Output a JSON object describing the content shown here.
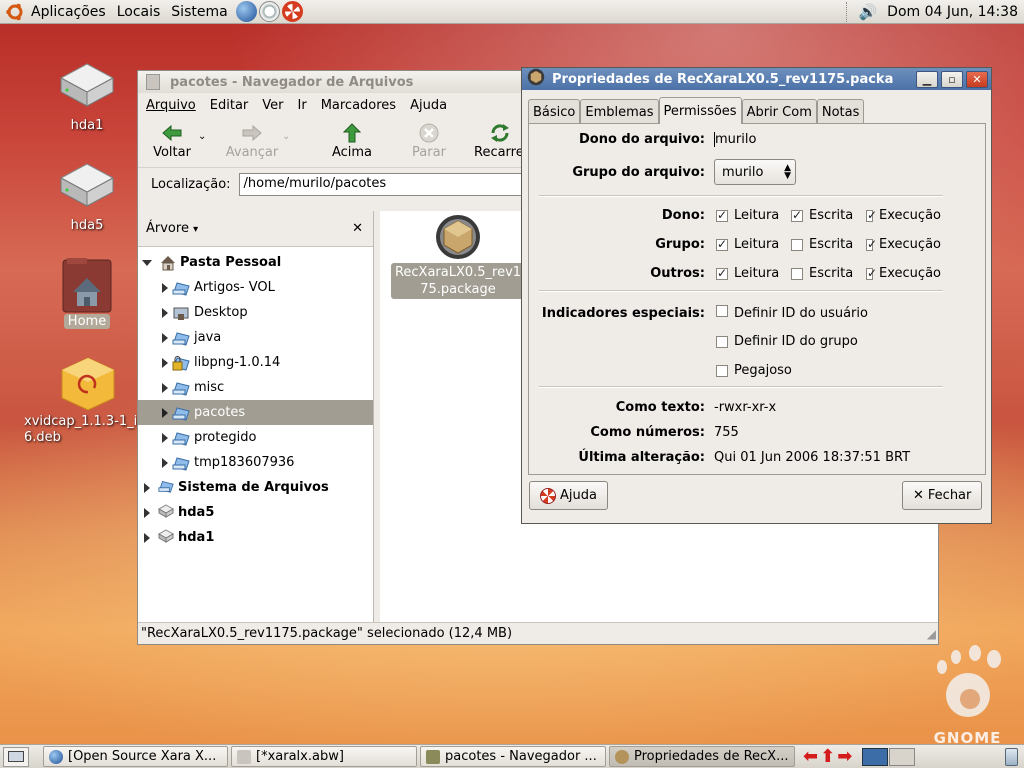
{
  "top_panel": {
    "menus": [
      "Aplicações",
      "Locais",
      "Sistema"
    ],
    "clock": "Dom 04 Jun, 14:38"
  },
  "desktop_icons": [
    {
      "label": "hda1",
      "icon": "drive-icon"
    },
    {
      "label": "hda5",
      "icon": "drive-icon"
    },
    {
      "label": "Home",
      "icon": "home-folder-icon"
    },
    {
      "label": "xvidcap_1.1.3-1_i\n6.deb",
      "icon": "deb-package-icon"
    }
  ],
  "nautilus": {
    "title": "pacotes - Navegador de Arquivos",
    "menus": [
      "Arquivo",
      "Editar",
      "Ver",
      "Ir",
      "Marcadores",
      "Ajuda"
    ],
    "toolbar": {
      "back": "Voltar",
      "forward": "Avançar",
      "up": "Acima",
      "stop": "Parar",
      "reload": "Recarre"
    },
    "location_label": "Localização:",
    "location_value": "/home/murilo/pacotes",
    "side_pane_title": "Árvore",
    "tree": {
      "home": "Pasta Pessoal",
      "children": [
        "Artigos- VOL",
        "Desktop",
        "java",
        "libpng-1.0.14",
        "misc",
        "pacotes",
        "protegido",
        "tmp183607936"
      ],
      "roots": [
        "Sistema de Arquivos",
        "hda5",
        "hda1"
      ]
    },
    "file_label_line1": "RecXaraLX0.5_rev1",
    "file_label_line2": "75.package",
    "status": "\"RecXaraLX0.5_rev1175.package\" selecionado (12,4 MB)"
  },
  "props": {
    "title": "Propriedades de RecXaraLX0.5_rev1175.packa",
    "tabs": [
      "Básico",
      "Emblemas",
      "Permissões",
      "Abrir Com",
      "Notas"
    ],
    "active_tab": "Permissões",
    "owner_label": "Dono do arquivo:",
    "owner_value": "murilo",
    "group_label": "Grupo do arquivo:",
    "group_value": "murilo",
    "perm_rows": [
      {
        "label": "Dono:",
        "read": true,
        "write": true,
        "exec": true
      },
      {
        "label": "Grupo:",
        "read": true,
        "write": false,
        "exec": true
      },
      {
        "label": "Outros:",
        "read": true,
        "write": false,
        "exec": true
      }
    ],
    "perm_read": "Leitura",
    "perm_write": "Escrita",
    "perm_exec": "Execução",
    "special_label": "Indicadores especiais:",
    "special_flags": [
      "Definir ID do usuário",
      "Definir ID do grupo",
      "Pegajoso"
    ],
    "as_text_label": "Como texto:",
    "as_text_value": "-rwxr-xr-x",
    "as_number_label": "Como números:",
    "as_number_value": "755",
    "last_changed_label": "Última alteração:",
    "last_changed_value": "Qui 01 Jun 2006 18:37:51 BRT",
    "help_button": "Ajuda",
    "close_button": "Fechar"
  },
  "taskbar": [
    {
      "label": "[Open Source Xara X...",
      "active": false
    },
    {
      "label": "[*xaralx.abw]",
      "active": false
    },
    {
      "label": "pacotes - Navegador ...",
      "active": false
    },
    {
      "label": "Propriedades de RecX...",
      "active": true
    }
  ],
  "gnome_brand": "GNOME"
}
